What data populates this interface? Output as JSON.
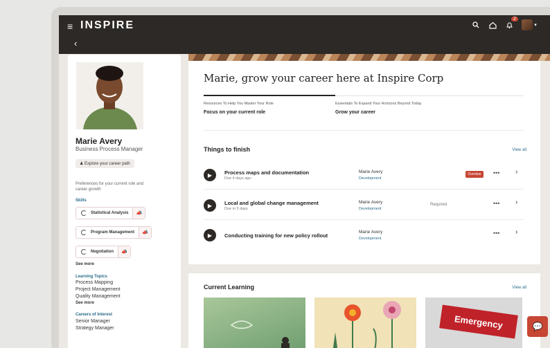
{
  "app": {
    "brand": "INSPIRE"
  },
  "topbar": {
    "notification_count": "2"
  },
  "profile": {
    "name": "Marie Avery",
    "role": "Business Process Manager",
    "explore_button": "Explore your career path",
    "preferences_text": "Preferences for your current role and career growth",
    "skills_label": "Skills",
    "skills": [
      "Statistical Analysis",
      "Program Management",
      "Negotiation"
    ],
    "see_more": "See more",
    "learning_topics_label": "Learning Topics",
    "learning_topics": [
      "Process Mapping",
      "Project Management",
      "Quality Management"
    ],
    "careers_label": "Careers of Interest",
    "careers": [
      "Senior Manager",
      "Strategy Manager"
    ]
  },
  "main": {
    "headline": "Marie, grow your career here at Inspire Corp",
    "resources": [
      {
        "caption": "Resources To Help You Master Your Role",
        "title": "Focus on your current role"
      },
      {
        "caption": "Essentials To Expand Your Horizons Beyond Today",
        "title": "Grow your career"
      }
    ],
    "things_title": "Things to finish",
    "view_all": "View all",
    "tasks": [
      {
        "title": "Process maps and documentation",
        "sub": "Due 4 days ago",
        "assignee": "Marie Avery",
        "dept": "Development",
        "status": "Overdue"
      },
      {
        "title": "Local and global change management",
        "sub": "Due in 3 days",
        "assignee": "Marie Avery",
        "dept": "Development",
        "status": "Required"
      },
      {
        "title": "Conducting training for new policy rollout",
        "sub": "",
        "assignee": "Marie Avery",
        "dept": "Development",
        "status": ""
      }
    ],
    "more_glyph": "•••",
    "current_learning_title": "Current Learning",
    "current_learning_view_all": "View all",
    "thumb3_text": "Emergency"
  }
}
